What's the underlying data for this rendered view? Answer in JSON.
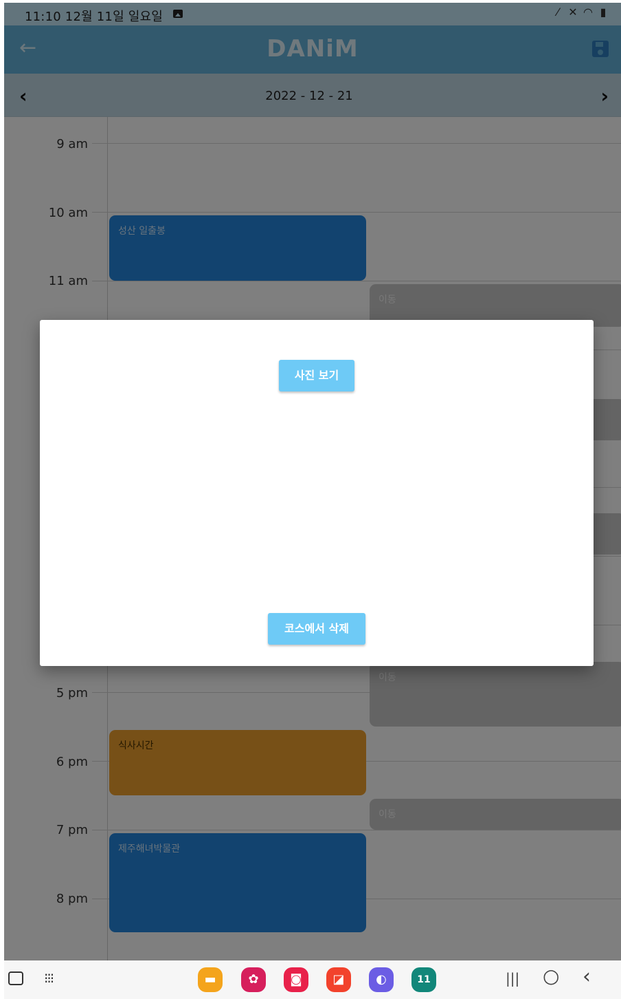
{
  "status_bar": {
    "time_date": "11:10  12월 11일 일요일",
    "icons": [
      "photo-icon",
      "pen-icon",
      "mute-icon",
      "wifi-icon",
      "battery-icon"
    ]
  },
  "app_bar": {
    "title": "DANiM",
    "back_icon": "arrow-back-icon",
    "save_icon": "save-icon"
  },
  "date_bar": {
    "date": "2022 - 12 - 21",
    "prev": "‹",
    "next": "›"
  },
  "timeline": {
    "hours": [
      "9 am",
      "10 am",
      "11 am",
      "5 pm",
      "6 pm",
      "7 pm",
      "8 pm"
    ],
    "events": [
      {
        "title": "성산 일출봉",
        "kind": "place",
        "color": "#2587de"
      },
      {
        "title": "이동",
        "kind": "move",
        "color": "#c9c9c9"
      },
      {
        "title": "이동",
        "kind": "move",
        "color": "#c9c9c9"
      },
      {
        "title": "식사시간",
        "kind": "meal",
        "color": "#eea12e"
      },
      {
        "title": "이동",
        "kind": "move",
        "color": "#c9c9c9"
      },
      {
        "title": "제주해녀박물관",
        "kind": "place",
        "color": "#2587de"
      }
    ]
  },
  "fab": {
    "label": "+"
  },
  "dialog": {
    "view_photos": "사진 보기",
    "delete_from_course": "코스에서 삭제"
  },
  "nav_bar": {
    "dock": [
      {
        "name": "my-files-icon",
        "color": "#f4a41c",
        "glyph": "▬"
      },
      {
        "name": "bixby-icon",
        "color": "#d61f5c",
        "glyph": "✿"
      },
      {
        "name": "camera-icon",
        "color": "#e8214a",
        "glyph": "◙"
      },
      {
        "name": "notes-icon",
        "color": "#f2422c",
        "glyph": "◪"
      },
      {
        "name": "internet-icon",
        "color": "#6b5de4",
        "glyph": "◐"
      },
      {
        "name": "calendar-icon",
        "color": "#12877a",
        "glyph": "11"
      }
    ],
    "recents": "|||",
    "home": "○",
    "back": "‹"
  }
}
